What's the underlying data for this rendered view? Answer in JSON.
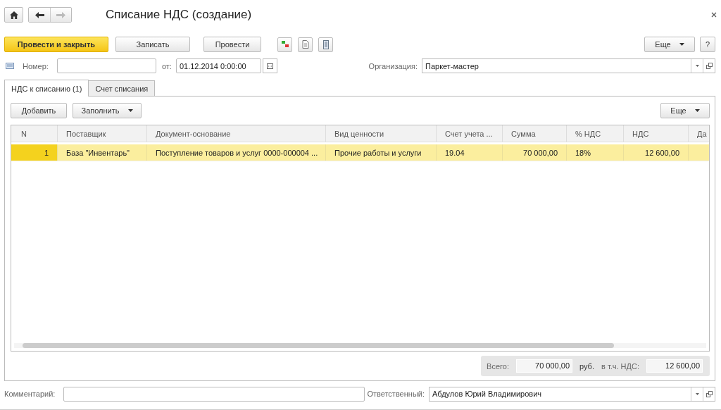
{
  "window": {
    "title": "Списание НДС (создание)"
  },
  "toolbar": {
    "buttons": [
      {
        "label": "Провести и закрыть",
        "kind": "primary"
      },
      {
        "label": "Записать",
        "kind": "normal"
      },
      {
        "label": "Провести",
        "kind": "normal"
      }
    ],
    "more": "Еще",
    "help": "?"
  },
  "header": {
    "number_label": "Номер:",
    "date_label": "от:",
    "date_value": "01.12.2014  0:00:00",
    "org_label": "Организация:",
    "org_value": "Паркет-мастер"
  },
  "tabs": [
    {
      "label": "НДС к списанию (1)",
      "selected": true
    },
    {
      "label": "Счет списания",
      "selected": false
    }
  ],
  "table_toolbar": {
    "add": "Добавить",
    "fill": "Заполнить",
    "more": "Еще"
  },
  "table": {
    "columns": [
      "N",
      "Поставщик",
      "Документ-основание",
      "Вид ценности",
      "Счет учета ...",
      "Сумма",
      "% НДС",
      "НДС",
      "Да"
    ],
    "rows": [
      {
        "selected": true,
        "cells": [
          "1",
          "База \"Инвентарь\"",
          "Поступление товаров и услуг 0000-000004 ...",
          "Прочие работы и услуги",
          "19.04",
          "70 000,00",
          "18%",
          "12 600,00",
          ""
        ]
      }
    ]
  },
  "totals": {
    "total_label": "Всего:",
    "total_value": "70 000,00",
    "currency": "руб.",
    "vat_label": "в т.ч. НДС:",
    "vat_value": "12 600,00"
  },
  "footer": {
    "comment_label": "Комментарий:",
    "responsible_label": "Ответственный:",
    "responsible_value": "Абдулов Юрий Владимирович"
  }
}
